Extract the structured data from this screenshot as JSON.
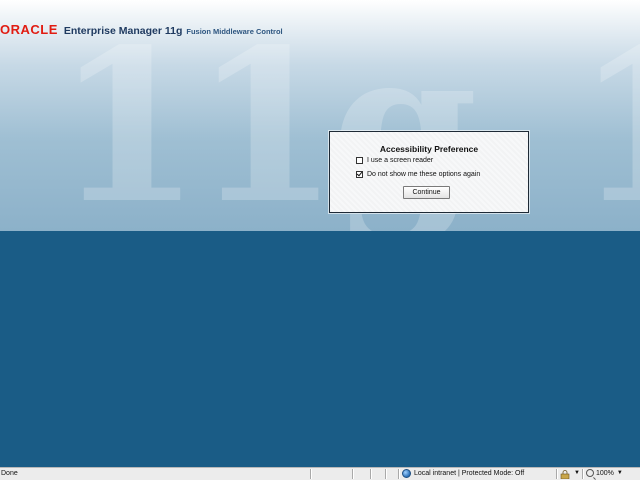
{
  "brand": {
    "logo_text": "ORACLE",
    "product": "Enterprise Manager 11g",
    "subtitle": "Fusion Middleware Control",
    "watermark": "11g",
    "watermark_right": "1"
  },
  "dialog": {
    "title": "Accessibility Preference",
    "options": [
      {
        "label": "I use a screen reader",
        "checked": false
      },
      {
        "label": "Do not show me these options again",
        "checked": true
      }
    ],
    "continue_label": "Continue"
  },
  "statusbar": {
    "status": "Done",
    "zone": "Local intranet | Protected Mode: Off",
    "zoom": "100%"
  },
  "colors": {
    "oracle_red": "#e11c12",
    "background_blue": "#1a5c86"
  }
}
